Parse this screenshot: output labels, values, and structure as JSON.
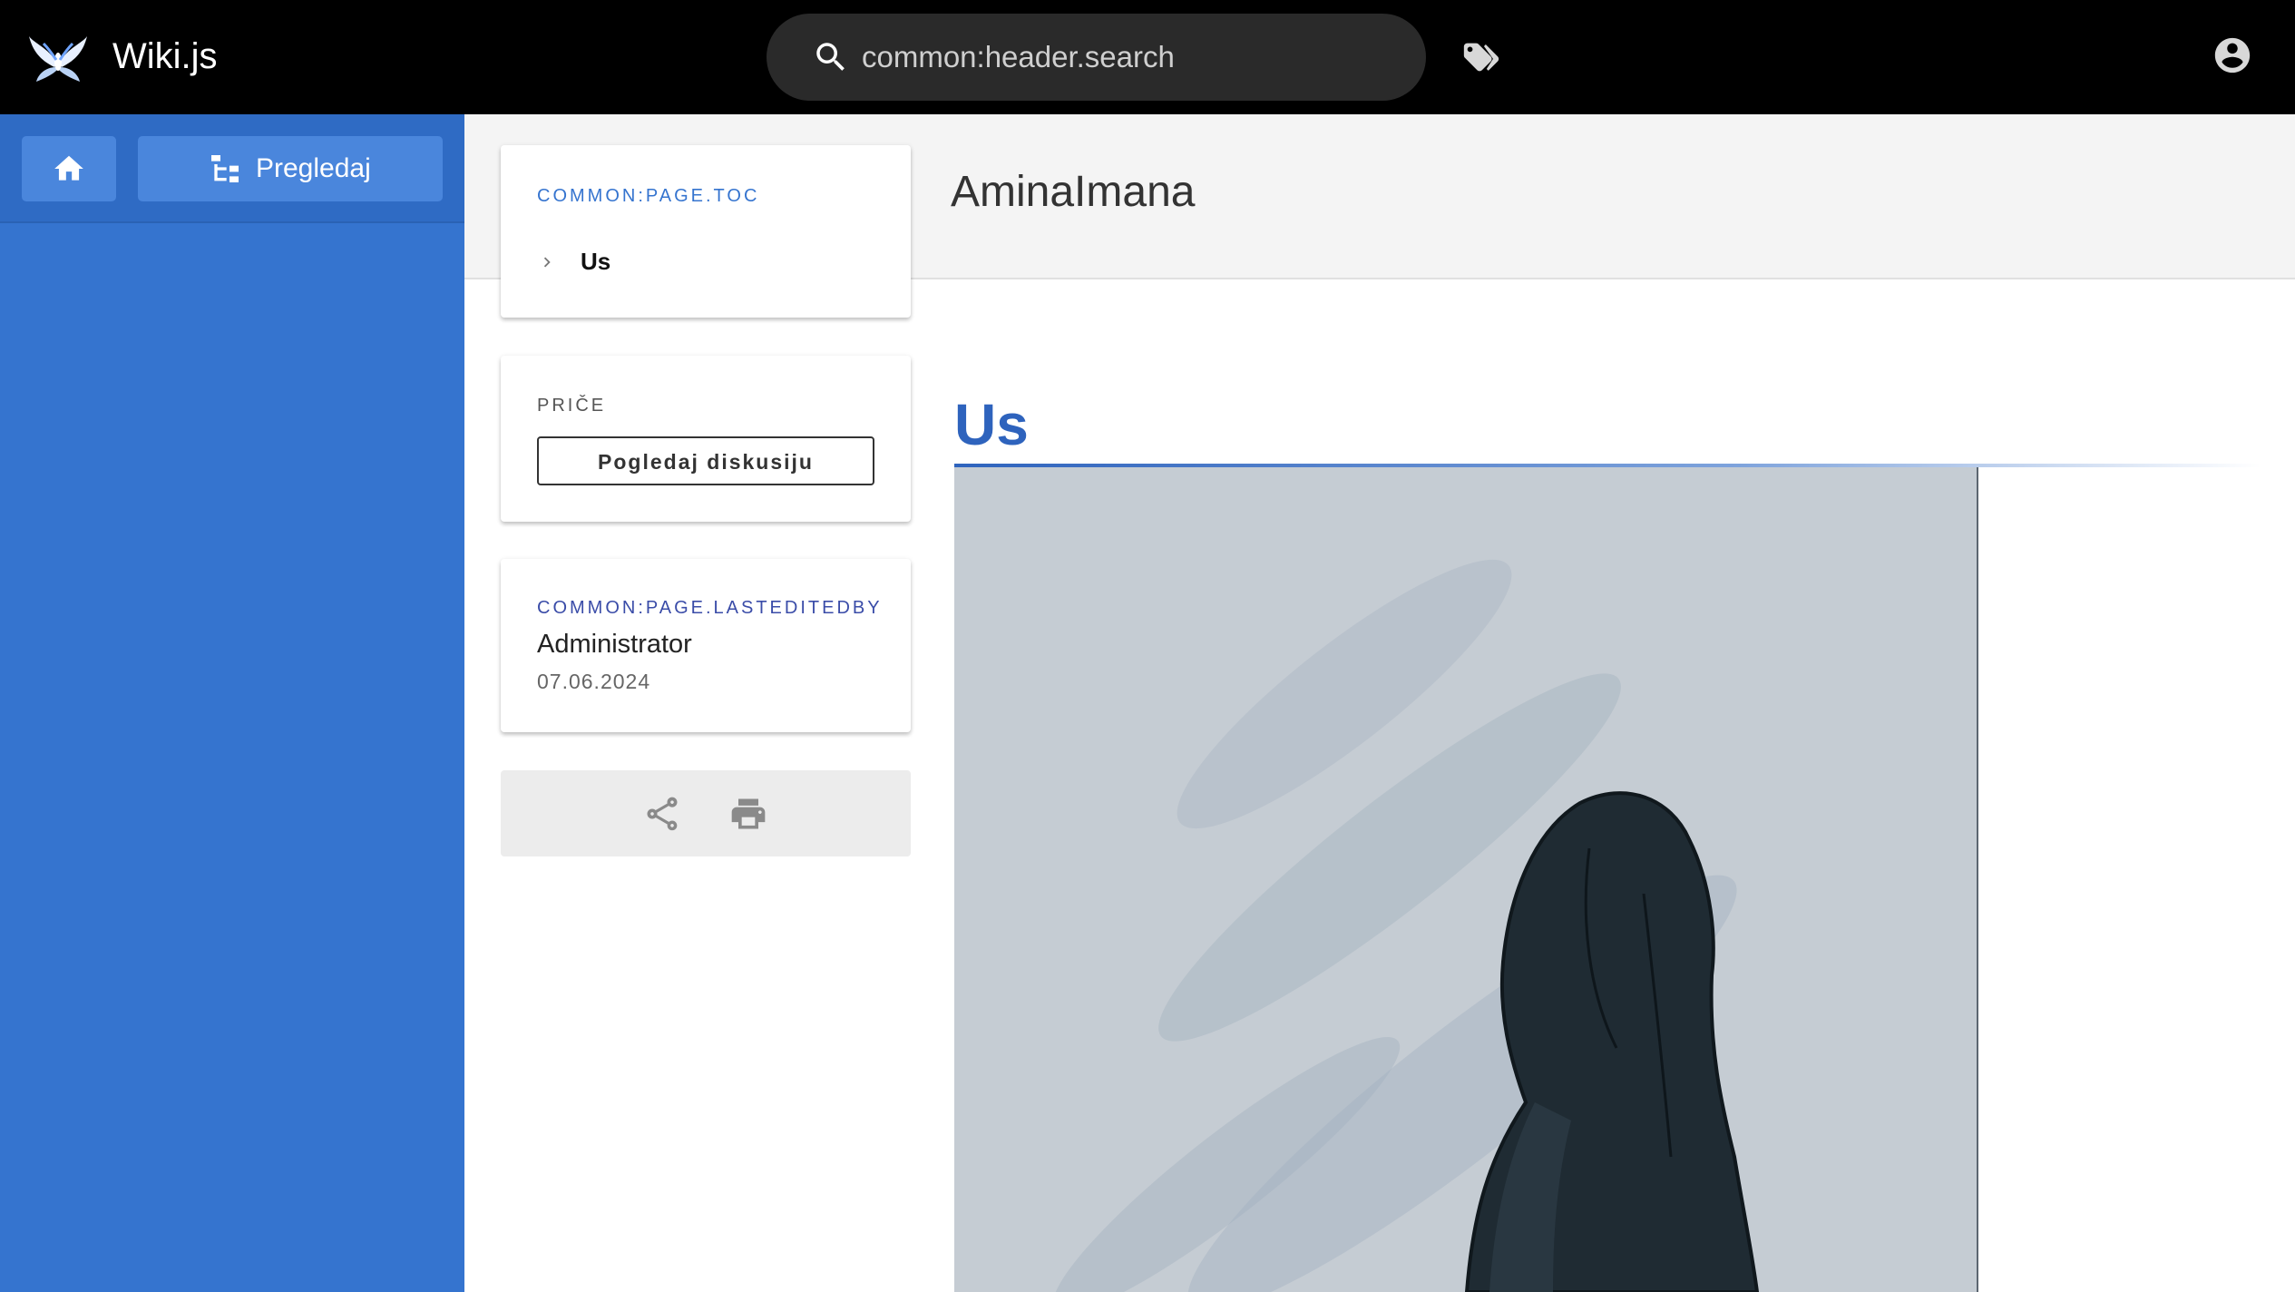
{
  "header": {
    "app_title": "Wiki.js",
    "search_placeholder": "common:header.search",
    "icons": {
      "logo": "wikijs-logo-icon",
      "search": "search-icon",
      "tags": "tags-icon",
      "account": "account-icon"
    }
  },
  "sidebar": {
    "home_icon": "home-icon",
    "browse_label": "Pregledaj",
    "browse_icon": "file-tree-icon",
    "background_color": "#3574cf"
  },
  "page": {
    "title": "AminaImana"
  },
  "toc": {
    "label": "COMMON:PAGE.TOC",
    "items": [
      {
        "label": "Us"
      }
    ]
  },
  "stories": {
    "label": "PRIČE",
    "discussion_button": "Pogledaj diskusiju"
  },
  "last_edit": {
    "label": "COMMON:PAGE.LASTEDITEDBY",
    "author": "Administrator",
    "date": "07.06.2024"
  },
  "actions": {
    "icons": [
      "share-icon",
      "print-icon"
    ]
  },
  "content": {
    "heading": "Us",
    "heading_color": "#2e63bd",
    "image_description_icon": "illustration-image"
  }
}
